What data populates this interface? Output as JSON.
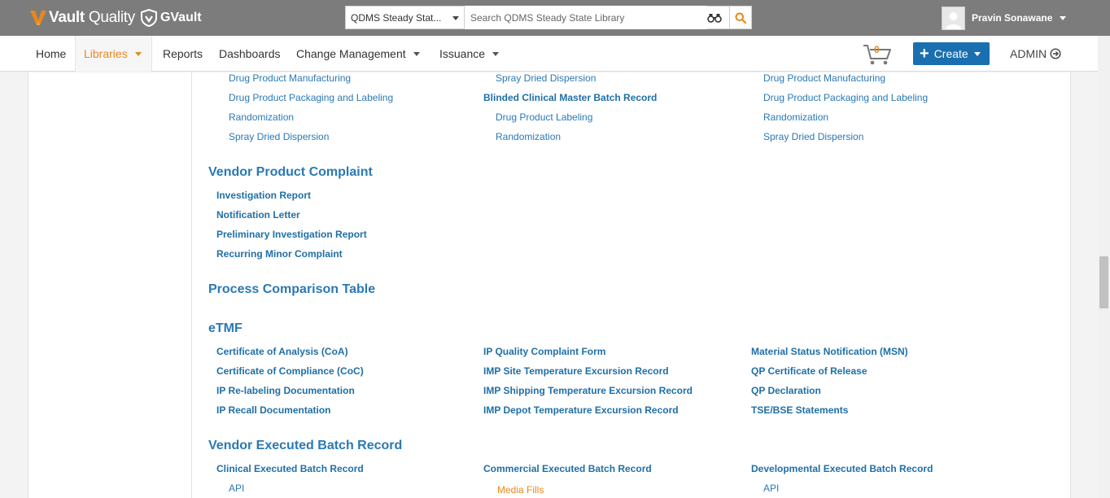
{
  "brand": {
    "vault_part1": "Vault",
    "vault_part2": "Quality",
    "gvault": "GVault",
    "accent": "#e8871e"
  },
  "search": {
    "scope_value": "QDMS Steady Stat...",
    "placeholder": "Search QDMS Steady State Library"
  },
  "user": {
    "name": "Pravin Sonawane"
  },
  "nav": {
    "home": "Home",
    "libraries": "Libraries",
    "reports": "Reports",
    "dashboards": "Dashboards",
    "change_management": "Change Management",
    "issuance": "Issuance"
  },
  "cart": {
    "count": "0"
  },
  "create_label": "Create",
  "admin_label": "ADMIN",
  "top_partial": {
    "col1": [
      "Drug Product Manufacturing",
      "Drug Product Packaging and Labeling",
      "Randomization",
      "Spray Dried Dispersion"
    ],
    "col2_sub1": "Spray Dried Dispersion",
    "col2_heading": "Blinded Clinical Master Batch Record",
    "col2_sub": [
      "Drug Product Labeling",
      "Randomization"
    ],
    "col3": [
      "Drug Product Manufacturing",
      "Drug Product Packaging and Labeling",
      "Randomization",
      "Spray Dried Dispersion"
    ]
  },
  "vendor_complaint": {
    "title": "Vendor Product Complaint",
    "items": [
      "Investigation Report",
      "Notification Letter",
      "Preliminary Investigation Report",
      "Recurring Minor Complaint"
    ]
  },
  "process_comparison": {
    "title": "Process Comparison Table"
  },
  "etmf": {
    "title": "eTMF",
    "col1": [
      "Certificate of Analysis (CoA)",
      "Certificate of Compliance (CoC)",
      "IP Re-labeling Documentation",
      "IP Recall Documentation"
    ],
    "col2": [
      "IP Quality Complaint Form",
      "IMP Site Temperature Excursion Record",
      "IMP Shipping Temperature Excursion Record",
      "IMP Depot Temperature Excursion Record"
    ],
    "col3": [
      "Material Status Notification (MSN)",
      "QP Certificate of Release",
      "QP Declaration",
      "TSE/BSE Statements"
    ]
  },
  "vendor_batch": {
    "title": "Vendor Executed Batch Record",
    "col1_heading": "Clinical Executed Batch Record",
    "col1_sub": "API",
    "col2_heading": "Commercial Executed Batch Record",
    "col2_sub": "Media Fills",
    "col3_heading": "Developmental Executed Batch Record",
    "col3_sub": "API"
  }
}
